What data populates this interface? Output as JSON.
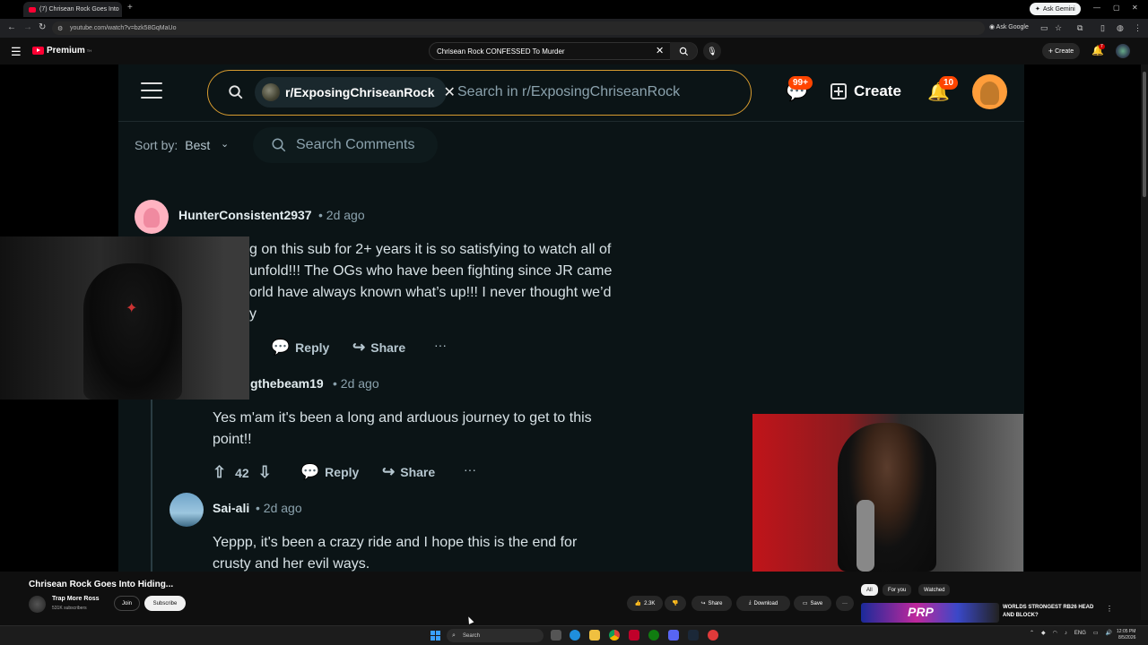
{
  "browser": {
    "tab_title": "(7) Chrisean Rock Goes Into",
    "url": "youtube.com/watch?v=bzk58GqMaUo",
    "ask_gemini": "Ask Gemini",
    "ask_google": "Ask Google"
  },
  "youtube_header": {
    "logo_text": "Premium",
    "logo_region": "TH",
    "search_value": "Chrisean Rock CONFESSED To Murder",
    "create_label": "Create",
    "notif_count": "7"
  },
  "reddit": {
    "subreddit_chip": "r/ExposingChriseanRock",
    "search_placeholder": "Search in r/ExposingChriseanRock",
    "chat_badge": "99+",
    "create_label": "Create",
    "bell_badge": "10",
    "sort_label": "Sort by:",
    "sort_value": "Best",
    "search_comments_placeholder": "Search Comments",
    "comments": [
      {
        "username": "HunterConsistent2937",
        "time": "• 2d ago",
        "lines": [
          "g on this sub for 2+ years it is so satisfying to watch all of",
          "unfold!!! The OGs who have been fighting since JR came",
          "orld have always known what’s up!!! I never thought we’d",
          "y"
        ],
        "reply": "Reply",
        "share": "Share"
      },
      {
        "username": "gthebeam19",
        "time": "• 2d ago",
        "lines": [
          "Yes m'am it's been a long and arduous journey to get to this",
          "point!!"
        ],
        "votes": "42",
        "reply": "Reply",
        "share": "Share"
      },
      {
        "username": "Sai-ali",
        "time": "• 2d ago",
        "lines": [
          "Yeppp, it's been a crazy ride and I hope this is the end for",
          "crusty and her evil ways."
        ]
      }
    ]
  },
  "video_info": {
    "title": "Chrisean Rock Goes Into Hiding...",
    "channel_name": "Trap More Ross",
    "subscribers": "531K subscribers",
    "join_label": "Join",
    "subscribe_label": "Subscribe",
    "likes": "2.3K",
    "share_label": "Share",
    "download_label": "Download",
    "save_label": "Save"
  },
  "recommendations": {
    "filters": [
      "All",
      "For you",
      "Watched"
    ],
    "thumb_text": "PRP",
    "title": "WORLDS STRONGEST RB26 HEAD AND BLOCK?"
  },
  "taskbar": {
    "search_placeholder": "Search",
    "lang": "ENG",
    "time": "12:05 PM",
    "date": "8/5/2026"
  },
  "colors": {
    "youtube_red": "#ff0033",
    "reddit_orange": "#ff4500",
    "search_border": "#d79b2f",
    "reddit_bg": "#0b1416"
  }
}
